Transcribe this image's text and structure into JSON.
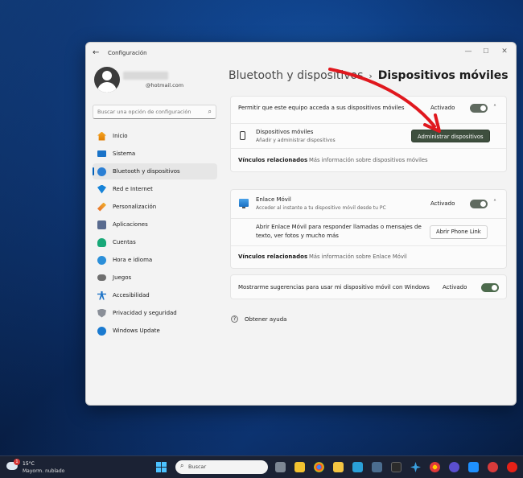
{
  "window": {
    "app_title": "Configuración"
  },
  "user": {
    "email": "@hotmail.com"
  },
  "sidebar": {
    "search_placeholder": "Buscar una opción de configuración",
    "items": [
      {
        "label": "Inicio",
        "icon": "home-icon"
      },
      {
        "label": "Sistema",
        "icon": "system-icon"
      },
      {
        "label": "Bluetooth y dispositivos",
        "icon": "bluetooth-icon",
        "active": true
      },
      {
        "label": "Red e Internet",
        "icon": "network-icon"
      },
      {
        "label": "Personalización",
        "icon": "brush-icon"
      },
      {
        "label": "Aplicaciones",
        "icon": "apps-icon"
      },
      {
        "label": "Cuentas",
        "icon": "accounts-icon"
      },
      {
        "label": "Hora e idioma",
        "icon": "globe-clock-icon"
      },
      {
        "label": "Juegos",
        "icon": "gamepad-icon"
      },
      {
        "label": "Accesibilidad",
        "icon": "accessibility-icon"
      },
      {
        "label": "Privacidad y seguridad",
        "icon": "shield-icon"
      },
      {
        "label": "Windows Update",
        "icon": "update-icon"
      }
    ]
  },
  "breadcrumb": {
    "parent": "Bluetooth y dispositivos",
    "separator": "›",
    "current": "Dispositivos móviles"
  },
  "mobile_devices_card": {
    "header_text": "Permitir que este equipo acceda a sus dispositivos móviles",
    "status": "Activado",
    "toggle_on": true,
    "device_title": "Dispositivos móviles",
    "device_subtitle": "Añadir y administrar dispositivos",
    "manage_button": "Administrar dispositivos",
    "related_label": "Vínculos relacionados",
    "related_link": "Más información sobre dispositivos móviles"
  },
  "phone_link_card": {
    "title": "Enlace Móvil",
    "subtitle": "Acceder al instante a tu dispositivo móvil desde tu PC",
    "status": "Activado",
    "toggle_on": true,
    "description_line1": "Abrir Enlace Móvil para responder llamadas o mensajes de",
    "description_line2": "texto, ver fotos y mucho más",
    "open_button": "Abrir Phone Link",
    "related_label": "Vínculos relacionados",
    "related_link": "Más información sobre Enlace Móvil"
  },
  "suggestions_card": {
    "text": "Mostrarme sugerencias para usar mi dispositivo móvil con Windows",
    "status": "Activado",
    "toggle_on": true
  },
  "help": {
    "label": "Obtener ayuda"
  },
  "taskbar": {
    "weather_temp": "15°C",
    "weather_desc": "Mayorm. nublado",
    "weather_badge": "1",
    "search_label": "Buscar"
  },
  "colors": {
    "accent": "#005fb8",
    "toggle_on": "#4d6b4d",
    "annotation_arrow": "#e0181e"
  }
}
